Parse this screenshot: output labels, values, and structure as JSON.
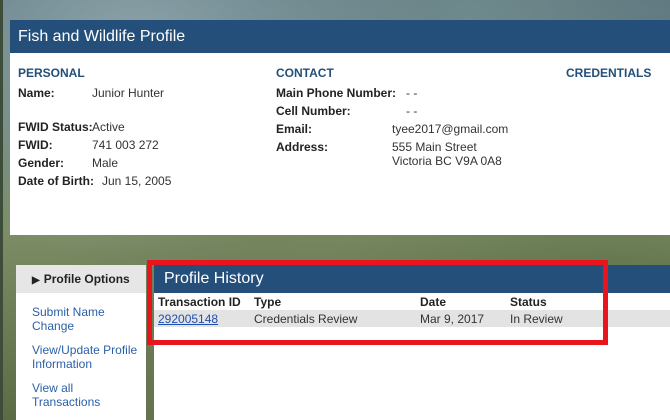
{
  "profile": {
    "title": "Fish and Wildlife Profile",
    "personal": {
      "heading": "PERSONAL",
      "name_label": "Name:",
      "name_value": "Junior Hunter",
      "fwid_status_label": "FWID Status:",
      "fwid_status_value": "Active",
      "fwid_label": "FWID:",
      "fwid_value": "741 003 272",
      "gender_label": "Gender:",
      "gender_value": "Male",
      "dob_label": "Date of Birth:",
      "dob_value": "Jun 15, 2005"
    },
    "contact": {
      "heading": "CONTACT",
      "main_phone_label": "Main Phone Number:",
      "main_phone_value": "- -",
      "cell_label": "Cell Number:",
      "cell_value": "- -",
      "email_label": "Email:",
      "email_value": "tyee2017@gmail.com",
      "address_label": "Address:",
      "address_line1": "555 Main Street",
      "address_line2": "Victoria BC V9A 0A8"
    },
    "credentials": {
      "heading": "CREDENTIALS"
    }
  },
  "nav": {
    "heading": "Profile Options",
    "links": [
      {
        "label_line1": "Submit Name",
        "label_line2": "Change"
      },
      {
        "label_line1": "View/Update Profile",
        "label_line2": "Information"
      },
      {
        "label_line1": "View all",
        "label_line2": "Transactions"
      }
    ]
  },
  "history": {
    "title": "Profile History",
    "columns": [
      "Transaction ID",
      "Type",
      "Date",
      "Status"
    ],
    "rows": [
      {
        "transaction_id": "292005148",
        "type": "Credentials Review",
        "date": "Mar 9, 2017",
        "status": "In Review"
      }
    ]
  },
  "colors": {
    "header_blue": "#234f7a",
    "link_blue": "#2a5fa8",
    "highlight_red": "#e8141e"
  }
}
